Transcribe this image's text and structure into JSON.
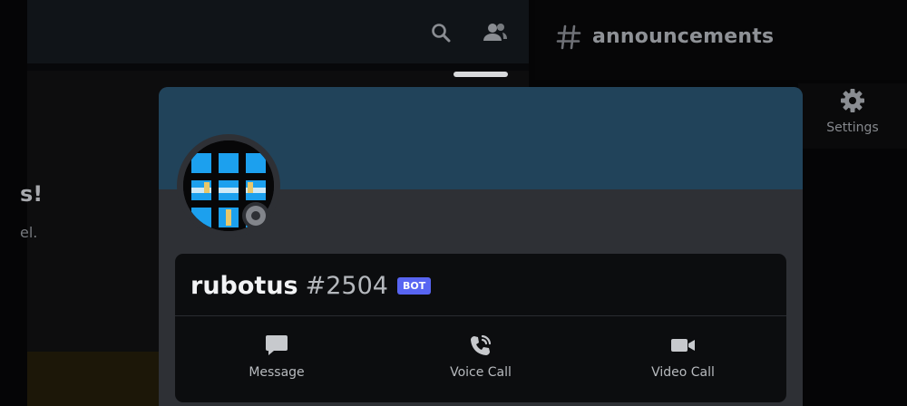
{
  "header": {
    "search_icon": "search-icon",
    "members_icon": "members-icon",
    "channel_icon": "hash-icon",
    "channel_name": "announcements"
  },
  "side_panel": {
    "settings_icon": "gear-icon",
    "settings_label": "Settings"
  },
  "background_text": {
    "welcome_title": "s!",
    "welcome_text": "el."
  },
  "profile": {
    "banner_color": "#21435a",
    "avatar_status": "offline",
    "username": "rubotus",
    "discriminator": "#2504",
    "badge": "BOT",
    "badge_color": "#5865f2"
  },
  "actions": [
    {
      "label": "Message",
      "icon": "message-icon"
    },
    {
      "label": "Voice Call",
      "icon": "phone-call-icon"
    },
    {
      "label": "Video Call",
      "icon": "video-camera-icon"
    }
  ]
}
